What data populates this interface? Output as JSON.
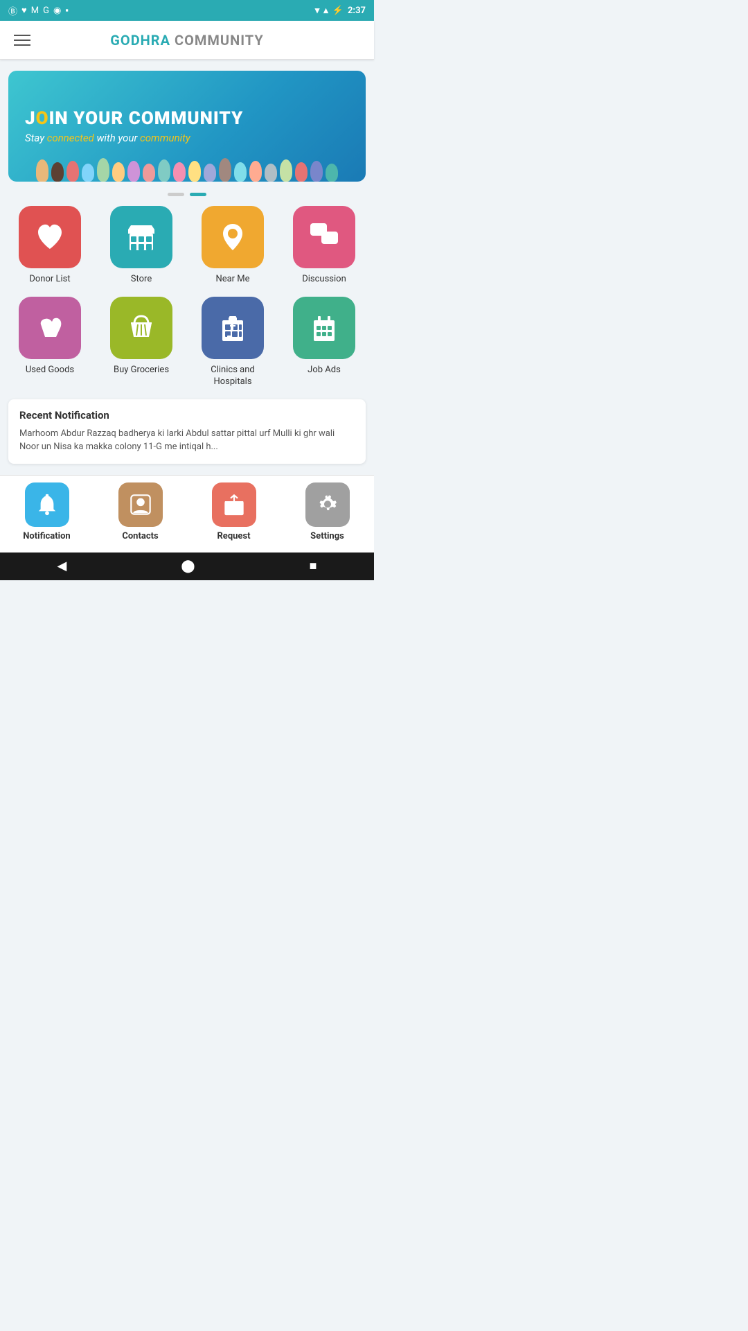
{
  "status": {
    "time": "2:37",
    "icons_left": [
      "B",
      "♥",
      "M",
      "G",
      "◎",
      "▪"
    ],
    "wifi": "▼",
    "signal": "▲",
    "battery": "🔋"
  },
  "header": {
    "title_part1": "GODHRA",
    "title_part2": " COMMUNITY"
  },
  "banner": {
    "title_prefix": "J",
    "title_highlight": "O",
    "title_suffix": "IN YOUR COMMUNITY",
    "subtitle_pre": "Stay ",
    "subtitle_highlight1": "connected",
    "subtitle_mid": " with your ",
    "subtitle_highlight2": "community"
  },
  "dots": [
    {
      "active": false
    },
    {
      "active": true
    }
  ],
  "grid_row1": [
    {
      "id": "donor-list",
      "label": "Donor List",
      "icon_class": "icon-red",
      "icon": "drop"
    },
    {
      "id": "store",
      "label": "Store",
      "icon_class": "icon-teal",
      "icon": "store"
    },
    {
      "id": "near-me",
      "label": "Near Me",
      "icon_class": "icon-orange",
      "icon": "pin"
    },
    {
      "id": "discussion",
      "label": "Discussion",
      "icon_class": "icon-pink",
      "icon": "chat"
    }
  ],
  "grid_row2": [
    {
      "id": "used-goods",
      "label": "Used Goods",
      "icon_class": "icon-purple",
      "icon": "key"
    },
    {
      "id": "buy-groceries",
      "label": "Buy Groceries",
      "icon_class": "icon-green",
      "icon": "basket"
    },
    {
      "id": "clinics",
      "label": "Clinics and Hospitals",
      "icon_class": "icon-blue",
      "icon": "hospital"
    },
    {
      "id": "job-ads",
      "label": "Job Ads",
      "icon_class": "icon-emerald",
      "icon": "building"
    }
  ],
  "notification": {
    "title": "Recent Notification",
    "text": "Marhoom Abdur Razzaq badherya ki larki Abdul sattar pittal urf Mulli ki ghr wali Noor un Nisa ka makka colony 11-G me intiqal h..."
  },
  "bottom_nav": [
    {
      "id": "notification",
      "label": "Notification",
      "icon": "bell",
      "color": "nav-blue"
    },
    {
      "id": "contacts",
      "label": "Contacts",
      "icon": "contact",
      "color": "nav-tan"
    },
    {
      "id": "request",
      "label": "Request",
      "icon": "mail-up",
      "color": "nav-salmon"
    },
    {
      "id": "settings",
      "label": "Settings",
      "icon": "gear",
      "color": "nav-gray"
    }
  ],
  "system_nav": {
    "back": "◀",
    "home": "⬤",
    "recent": "■"
  }
}
